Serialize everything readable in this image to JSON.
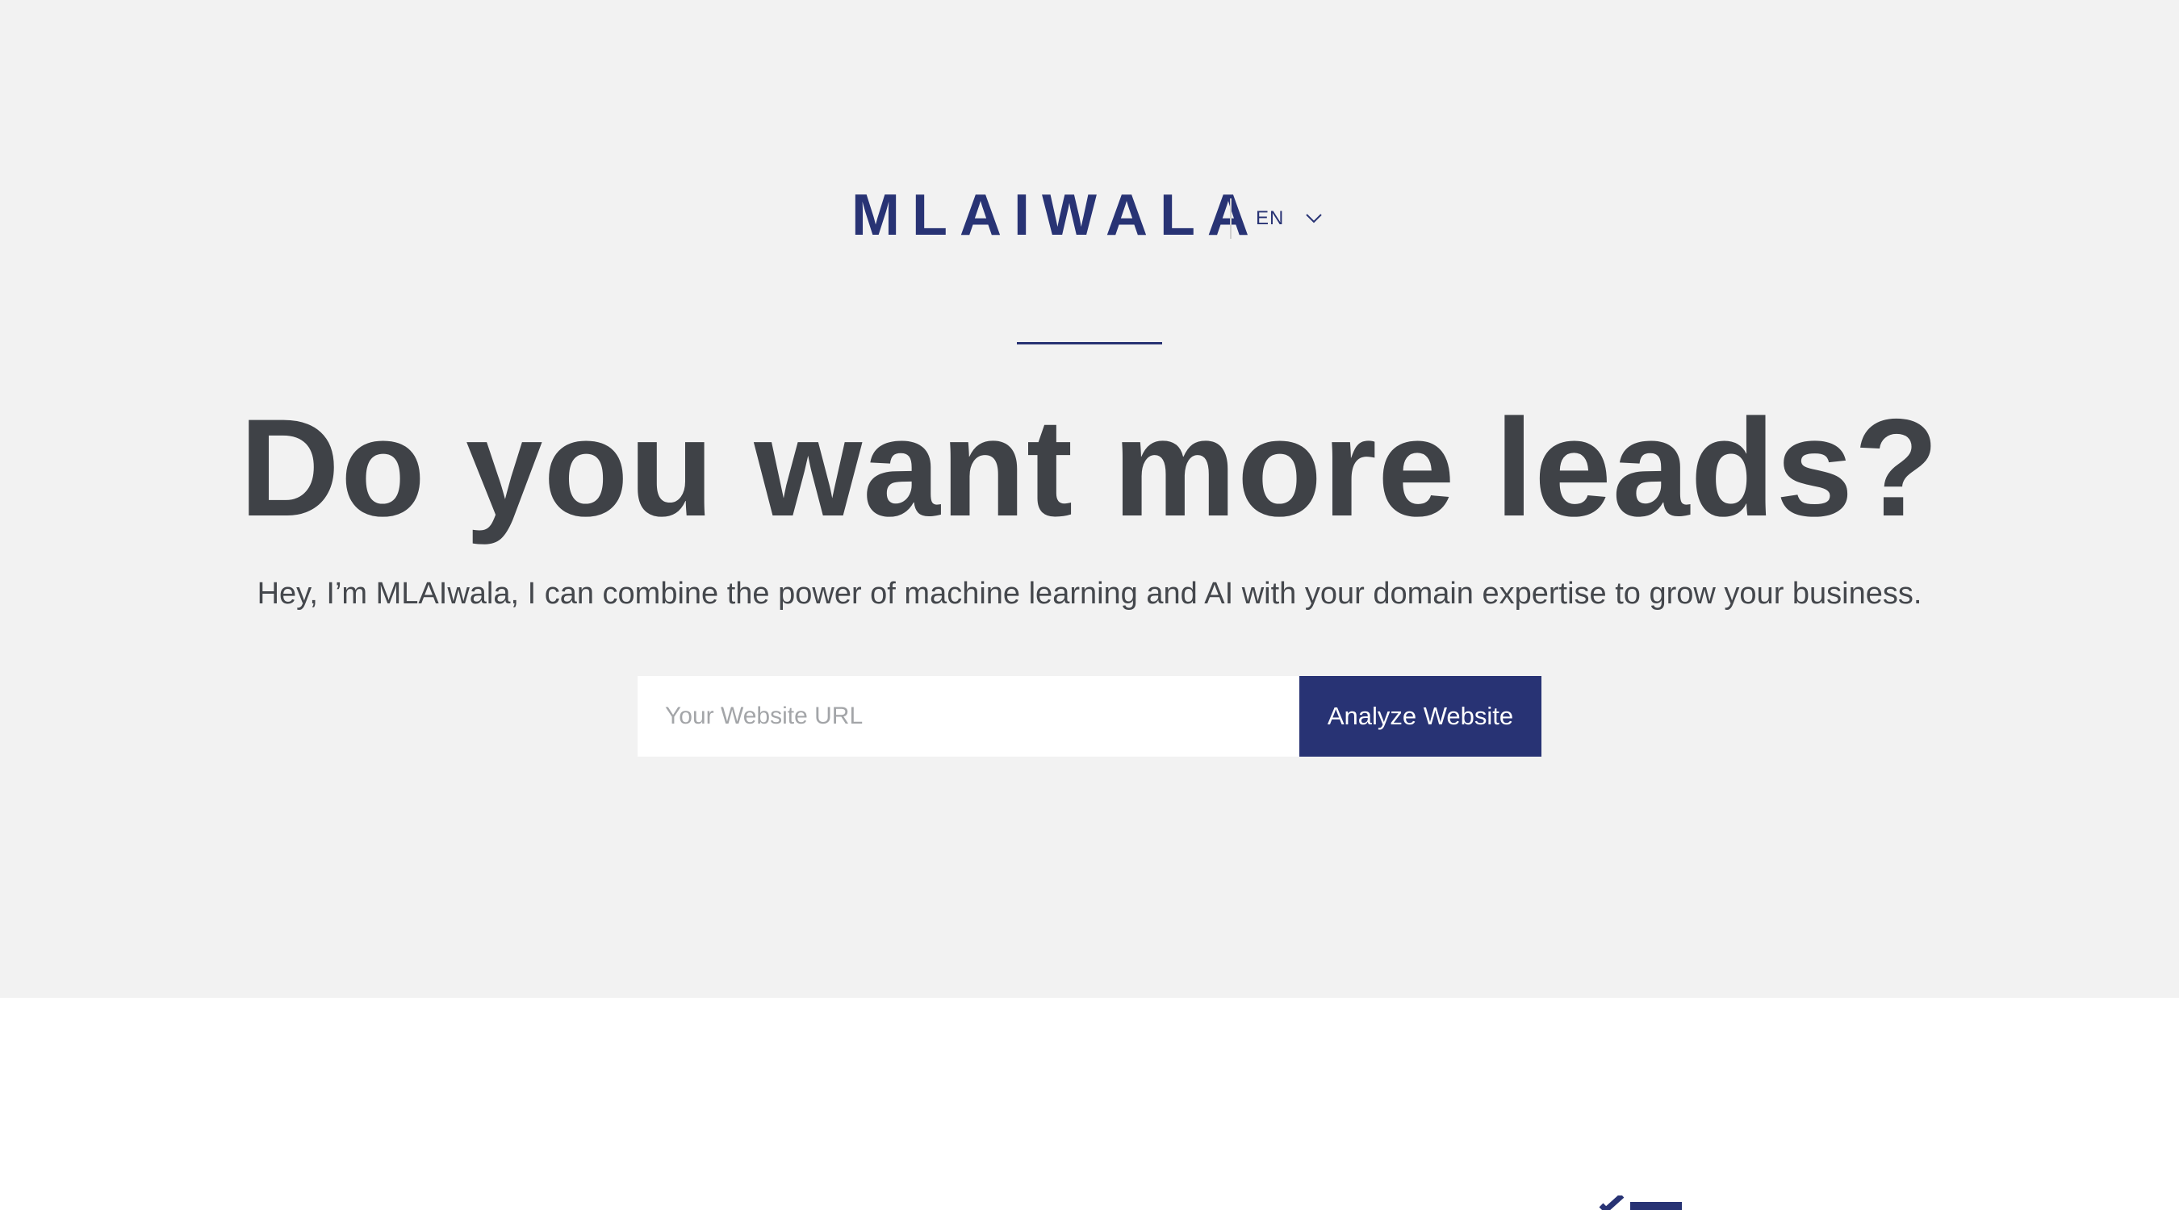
{
  "brand": {
    "logo_text": "MLAIWALA",
    "language": "EN"
  },
  "hero": {
    "headline": "Do you want more leads?",
    "subheadline": "Hey, I’m MLAIwala, I can combine the power of machine learning and AI with your domain expertise to grow your business.",
    "url_input": {
      "placeholder": "Your Website URL",
      "value": ""
    },
    "cta_label": "Analyze Website"
  },
  "icons": {
    "language_dropdown": "chevron-down-icon",
    "feature_peek": "checklist-icon"
  },
  "colors": {
    "brand": "#283374",
    "hero_background": "#f2f2f2",
    "headline": "#3f4247",
    "page_background": "#ffffff"
  }
}
